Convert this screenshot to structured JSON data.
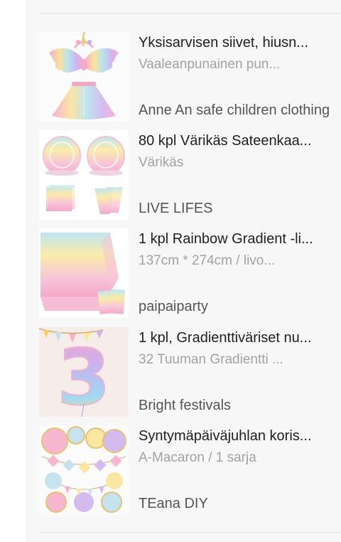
{
  "products": [
    {
      "title": "Yksisarvisen siivet, hiusn...",
      "variant": "Vaaleanpunainen pun...",
      "store": "Anne An safe children clothing",
      "icon": "unicorn-wings-tutu-image"
    },
    {
      "title": "80 kpl Värikäs Sateenkaa...",
      "variant": "Värikäs",
      "store": "LIVE LIFES",
      "icon": "rainbow-party-plates-image"
    },
    {
      "title": "1 kpl Rainbow Gradient -li...",
      "variant": "137cm * 274cm / livo...",
      "store": "paipaiparty",
      "icon": "rainbow-tablecloth-image"
    },
    {
      "title": "1 kpl, Gradienttiväriset nu...",
      "variant": "32 Tuuman Gradientti ...",
      "store": "Bright festivals",
      "icon": "number-three-balloon-image"
    },
    {
      "title": "Syntymäpäiväjuhlan koris...",
      "variant": "A-Macaron / 1 sarja",
      "store": "TEana DIY",
      "icon": "birthday-decoration-image"
    }
  ],
  "colors": {
    "pastel_pink": "#f6b8d2",
    "pastel_blue": "#b9dff2",
    "pastel_yellow": "#fbeea7",
    "pastel_purple": "#d3b9ee",
    "panel_bg": "#f7f7f7"
  }
}
